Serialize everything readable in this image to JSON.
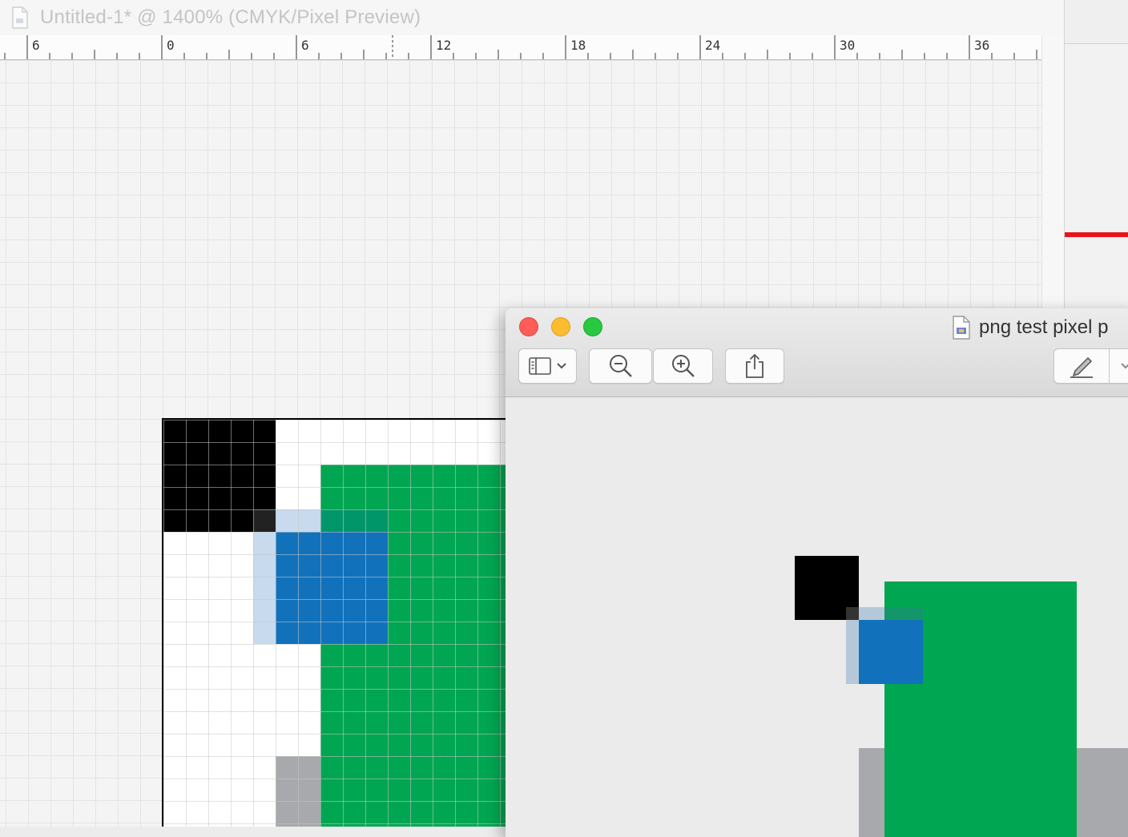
{
  "illustrator": {
    "title": "Untitled-1* @ 1400% (CMYK/Pixel Preview)",
    "ruler_labels": [
      "6",
      "0",
      "6",
      "12",
      "18",
      "24",
      "30",
      "36"
    ]
  },
  "preview": {
    "title": "png test pixel p"
  },
  "icons": {
    "document": "document-icon",
    "sidebar": "sidebar-toggle-icon",
    "chevron": "chevron-down-icon",
    "zoom_out": "zoom-out-icon",
    "zoom_in": "zoom-in-icon",
    "share": "share-icon",
    "markup": "markup-pen-icon"
  },
  "colors": {
    "black": "#000000",
    "green": "#00a651",
    "blue": "#1172bb",
    "light_blue": "#c7daee",
    "gray": "#a7a9ac",
    "red_accent": "#e8141a"
  }
}
